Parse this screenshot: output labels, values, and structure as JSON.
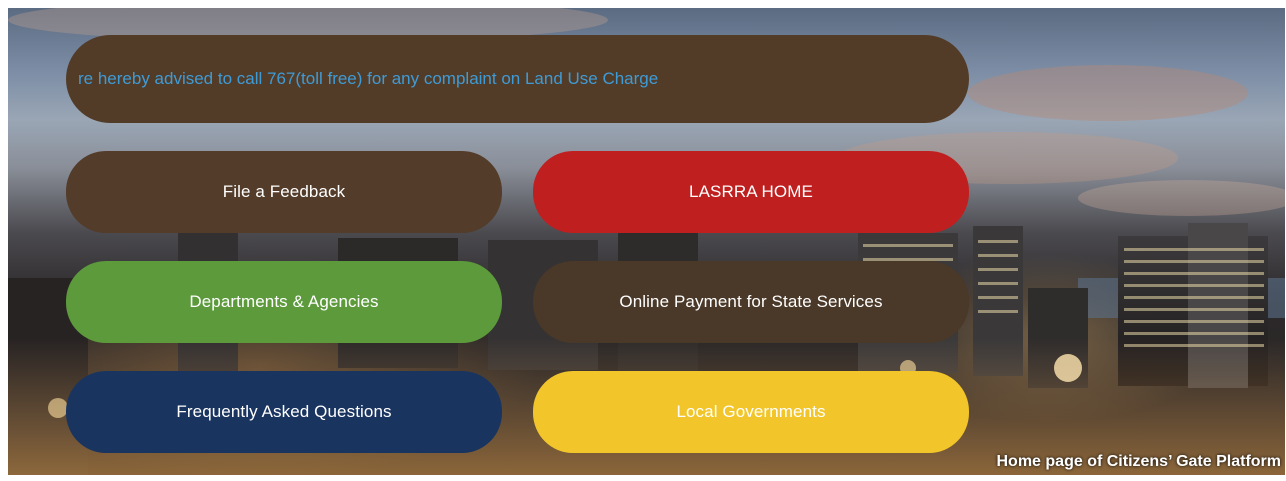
{
  "banner": {
    "marquee_text": "re hereby advised to call 767(toll free) for any complaint on Land Use Charge"
  },
  "buttons": {
    "feedback": {
      "label": "File a Feedback",
      "color": "#533c29"
    },
    "lasrra_home": {
      "label": "LASRRA HOME",
      "color": "#c01f1f"
    },
    "departments": {
      "label": "Departments & Agencies",
      "color": "#5c9a3c"
    },
    "online_payment": {
      "label": "Online Payment for State Services",
      "color": "#4a3828"
    },
    "faq": {
      "label": "Frequently Asked Questions",
      "color": "#1a3460"
    },
    "local_governments": {
      "label": "Local Governments",
      "color": "#f2c62a"
    }
  },
  "caption": "Home page  of Citizens’ Gate Platform",
  "icons": {
    "background": "city-skyline-photo"
  }
}
